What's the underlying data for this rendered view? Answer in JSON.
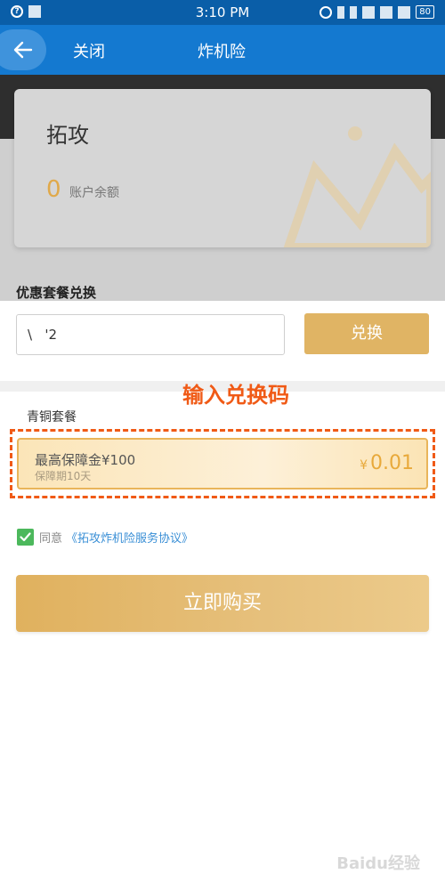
{
  "status_bar": {
    "time": "3:10 PM",
    "battery": "80"
  },
  "header": {
    "close_label": "关闭",
    "title": "炸机险"
  },
  "account": {
    "name": "拓攻",
    "balance": "0",
    "balance_label": "账户余额"
  },
  "redeem": {
    "section_title": "优惠套餐兑换",
    "code_value": "\\   '2",
    "button_label": "兑换"
  },
  "annotation": "输入兑换码",
  "package": {
    "name": "青铜套餐",
    "title": "最高保障金¥100",
    "period": "保障期10天",
    "currency": "¥",
    "price": "0.01"
  },
  "agreement": {
    "checked": true,
    "prefix": "同意",
    "link": "《拓攻炸机险服务协议》"
  },
  "buy_button": "立即购买",
  "watermark": "Baidu经验",
  "colors": {
    "header": "#1479d0",
    "gold": "#e0b464",
    "annotation": "#f05a16",
    "link": "#3a8fd6",
    "check": "#4cb85c"
  }
}
